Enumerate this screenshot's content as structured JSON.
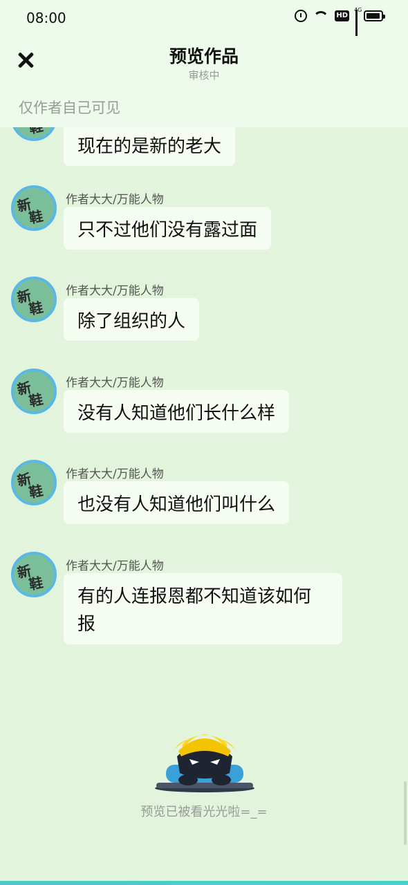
{
  "status_bar": {
    "time": "08:00",
    "icons": [
      "alarm-icon",
      "wifi-icon",
      "hd-icon",
      "signal-4g-icon",
      "battery-icon"
    ],
    "hd_label": "HD",
    "network_label": "4G"
  },
  "header": {
    "title": "预览作品",
    "subtitle": "审核中",
    "visibility_note": "仅作者自己可见"
  },
  "avatar_text": [
    "新",
    "鞋"
  ],
  "messages": [
    {
      "author": "",
      "text": "现在的是新的老大"
    },
    {
      "author": "作者大大/万能人物",
      "text": "只不过他们没有露过面"
    },
    {
      "author": "作者大大/万能人物",
      "text": "除了组织的人"
    },
    {
      "author": "作者大大/万能人物",
      "text": "没有人知道他们长什么样"
    },
    {
      "author": "作者大大/万能人物",
      "text": "也没有人知道他们叫什么"
    },
    {
      "author": "作者大大/万能人物",
      "text": "有的人连报恩都不知道该如何报"
    }
  ],
  "footer": {
    "end_text": "预览已被看光光啦=_="
  },
  "colors": {
    "background": "#e3f4dc",
    "header_bg": "#eefbec",
    "bubble_bg": "#f5fdf2",
    "avatar_ring": "#5ab8e6",
    "bottom_bar": "#4ad0c8"
  }
}
